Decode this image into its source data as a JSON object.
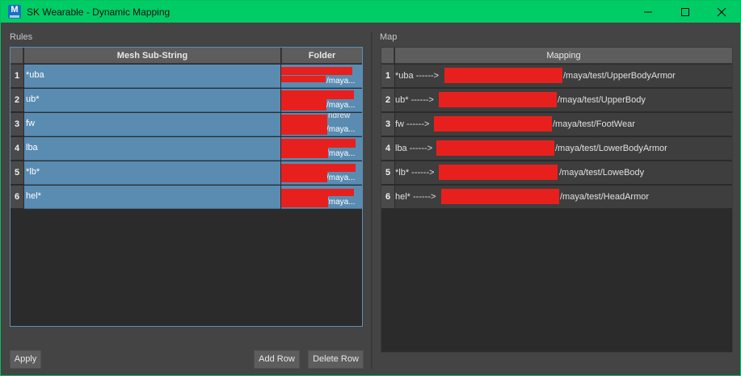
{
  "window": {
    "title": "SK Wearable - Dynamic Mapping",
    "icon_letter": "M",
    "accent_color": "#00cc66"
  },
  "rules": {
    "label": "Rules",
    "headers": {
      "mesh": "Mesh Sub-String",
      "folder": "Folder"
    },
    "rows": [
      {
        "num": "1",
        "mesh": "*uba",
        "folder_top": "",
        "folder_bottom": "/maya..."
      },
      {
        "num": "2",
        "mesh": "ub*",
        "folder_top": "",
        "folder_bottom": "/maya..."
      },
      {
        "num": "3",
        "mesh": "fw",
        "folder_top": "ndrew",
        "folder_bottom": "/maya..."
      },
      {
        "num": "4",
        "mesh": "lba",
        "folder_top": "",
        "folder_bottom": "/maya..."
      },
      {
        "num": "5",
        "mesh": "*lb*",
        "folder_top": "",
        "folder_bottom": "/maya..."
      },
      {
        "num": "6",
        "mesh": "hel*",
        "folder_top": "",
        "folder_bottom": "/maya..."
      }
    ]
  },
  "map": {
    "label": "Map",
    "header": "Mapping",
    "rows": [
      {
        "num": "1",
        "prefix": "*uba ------>",
        "suffix": "/maya/test/UpperBodyArmor"
      },
      {
        "num": "2",
        "prefix": "ub* ------>",
        "suffix": "/maya/test/UpperBody"
      },
      {
        "num": "3",
        "prefix": "fw ------>",
        "suffix": "/maya/test/FootWear"
      },
      {
        "num": "4",
        "prefix": "lba ------>",
        "suffix": "/maya/test/LowerBodyArmor"
      },
      {
        "num": "5",
        "prefix": "*lb* ------>",
        "suffix": "/maya/test/LoweBody"
      },
      {
        "num": "6",
        "prefix": "hel* ------>",
        "suffix": "/maya/test/HeadArmor"
      }
    ]
  },
  "buttons": {
    "apply": "Apply",
    "add_row": "Add Row",
    "delete_row": "Delete Row"
  },
  "icons": {
    "minimize": "minimize-icon",
    "maximize": "maximize-icon",
    "close": "close-icon"
  }
}
